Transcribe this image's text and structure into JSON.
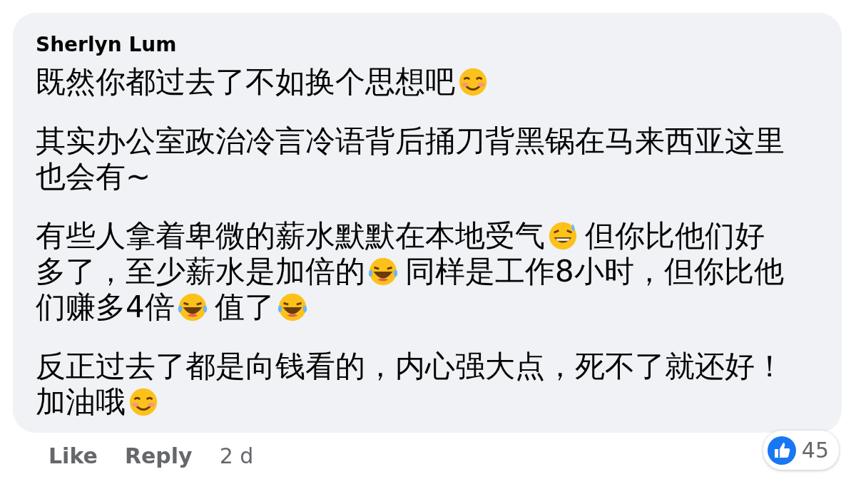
{
  "comment": {
    "author": "Sherlyn Lum",
    "paragraphs": [
      {
        "lines": [
          [
            {
              "kind": "text",
              "text": "既然你都过去了不如换个思想吧"
            },
            {
              "kind": "smile"
            }
          ]
        ]
      },
      {
        "lines": [
          [
            {
              "kind": "text",
              "text": "其实办公室政治冷言冷语背后捅刀背黑锅在马来西亚这里"
            }
          ],
          [
            {
              "kind": "text",
              "text": "也会有~"
            }
          ]
        ]
      },
      {
        "lines": [
          [
            {
              "kind": "text",
              "text": "有些人拿着卑微的薪水默默在本地受气"
            },
            {
              "kind": "sweat"
            },
            {
              "kind": "text",
              "text": "但你比他们好"
            }
          ],
          [
            {
              "kind": "text",
              "text": "多了，至少薪水是加倍的"
            },
            {
              "kind": "tears"
            },
            {
              "kind": "text",
              "text": "同样是工作8小时，但你比他"
            }
          ],
          [
            {
              "kind": "text",
              "text": "们赚多4倍"
            },
            {
              "kind": "tears"
            },
            {
              "kind": "text",
              "text": "值了"
            },
            {
              "kind": "tears"
            }
          ]
        ]
      },
      {
        "lines": [
          [
            {
              "kind": "text",
              "text": "反正过去了都是向钱看的，内心强大点，死不了就还好！"
            }
          ],
          [
            {
              "kind": "text",
              "text": "加油哦"
            },
            {
              "kind": "smile"
            }
          ]
        ]
      }
    ]
  },
  "actions": [
    {
      "label": "Like"
    },
    {
      "label": "Reply"
    }
  ],
  "time": "2 d",
  "reactions": {
    "count": "45"
  }
}
